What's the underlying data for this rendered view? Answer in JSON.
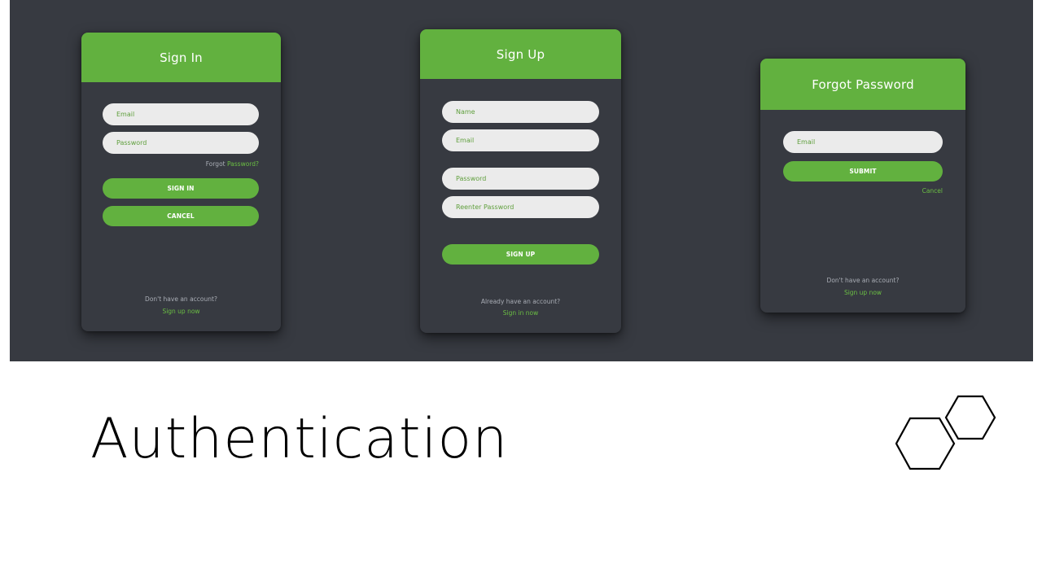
{
  "slide": {
    "title": "Authentication"
  },
  "signin": {
    "header": "Sign In",
    "email_placeholder": "Email",
    "password_placeholder": "Password",
    "forgot_prefix": "Forgot ",
    "forgot_link": "Password?",
    "signin_button": "SIGN IN",
    "cancel_button": "CANCEL",
    "footer_text": "Don't have an account?",
    "footer_link": "Sign up now"
  },
  "signup": {
    "header": "Sign Up",
    "name_placeholder": "Name",
    "email_placeholder": "Email",
    "password_placeholder": "Password",
    "reenter_placeholder": "Reenter Password",
    "signup_button": "SIGN UP",
    "footer_text": "Already have an account?",
    "footer_link": "Sign in now"
  },
  "forgot": {
    "header": "Forgot Password",
    "email_placeholder": "Email",
    "submit_button": "SUBMIT",
    "cancel_link": "Cancel",
    "footer_text": "Don't have an account?",
    "footer_link": "Sign up now"
  },
  "colors": {
    "accent": "#62b13f",
    "panel": "#373a41",
    "field": "#ebebeb"
  },
  "icons": [
    "hexagon-icon"
  ]
}
